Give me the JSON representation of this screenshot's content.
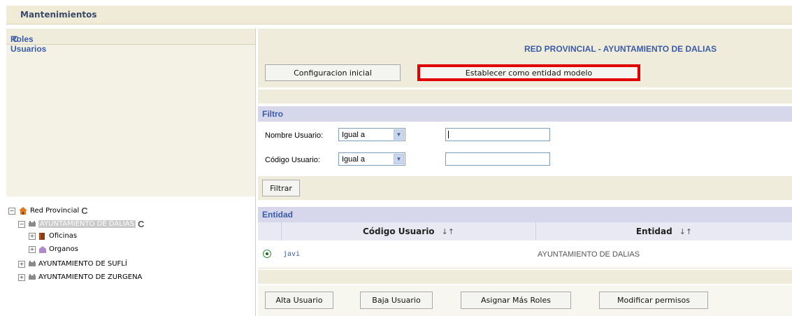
{
  "topbar": {
    "title": "Mantenimientos"
  },
  "left": {
    "roles_title": "Roles Usuarios",
    "refresh_glyph": "C",
    "tree": [
      {
        "label": "Red Provincial",
        "toggle": "−",
        "icon": "home-icon"
      },
      {
        "label": "AYUNTAMIENTO DE DALIAS",
        "toggle": "−",
        "icon": "building-icon",
        "selected": true
      },
      {
        "label": "Oficinas",
        "toggle": "+",
        "icon": "book-icon"
      },
      {
        "label": "Organos",
        "toggle": "+",
        "icon": "organ-icon"
      },
      {
        "label": "AYUNTAMIENTO DE SUFLÍ",
        "toggle": "+",
        "icon": "building-icon"
      },
      {
        "label": "AYUNTAMIENTO DE ZURGENA",
        "toggle": "+",
        "icon": "building-icon"
      }
    ]
  },
  "main": {
    "entity_title": "RED PROVINCIAL - AYUNTAMIENTO DE DALIAS",
    "config_button": "Configuracion inicial",
    "model_button": "Establecer como entidad modelo",
    "highlight_color": "#e00000",
    "filter": {
      "title": "Filtro",
      "nombre_label": "Nombre Usuario:",
      "nombre_op": "Igual a",
      "codigo_label": "Código Usuario:",
      "codigo_op": "Igual a",
      "button": "Filtrar"
    },
    "table": {
      "title": "Entidad",
      "col_codigo": "Código Usuario",
      "col_entidad": "Entidad",
      "sort_glyph": "↓↑",
      "rows": [
        {
          "codigo": "javi",
          "entidad": "AYUNTAMIENTO DE DALIAS",
          "selected": true
        }
      ]
    },
    "actions": {
      "alta": "Alta Usuario",
      "baja": "Baja Usuario",
      "asignar": "Asignar Más Roles",
      "modificar": "Modificar permisos"
    }
  }
}
